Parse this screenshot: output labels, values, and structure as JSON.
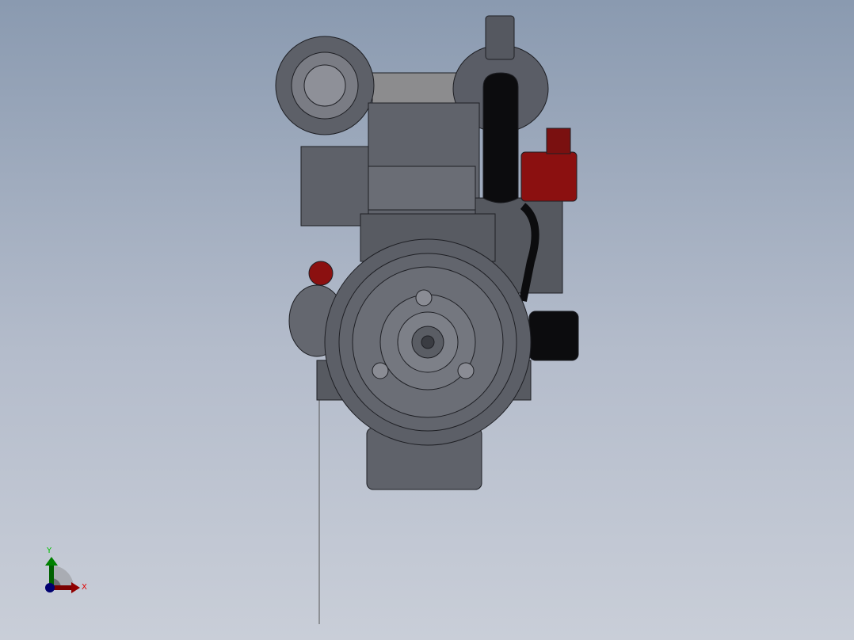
{
  "viewport": {
    "model": "engine-assembly",
    "view": "front"
  },
  "triad": {
    "x_label": "X",
    "y_label": "Y",
    "x_color": "#c00000",
    "y_color": "#00a000",
    "z_color": "#000080"
  },
  "colors": {
    "metal": "#5c5f68",
    "dark": "#3a3c42",
    "red": "#8b1010",
    "black": "#0c0c0e"
  }
}
